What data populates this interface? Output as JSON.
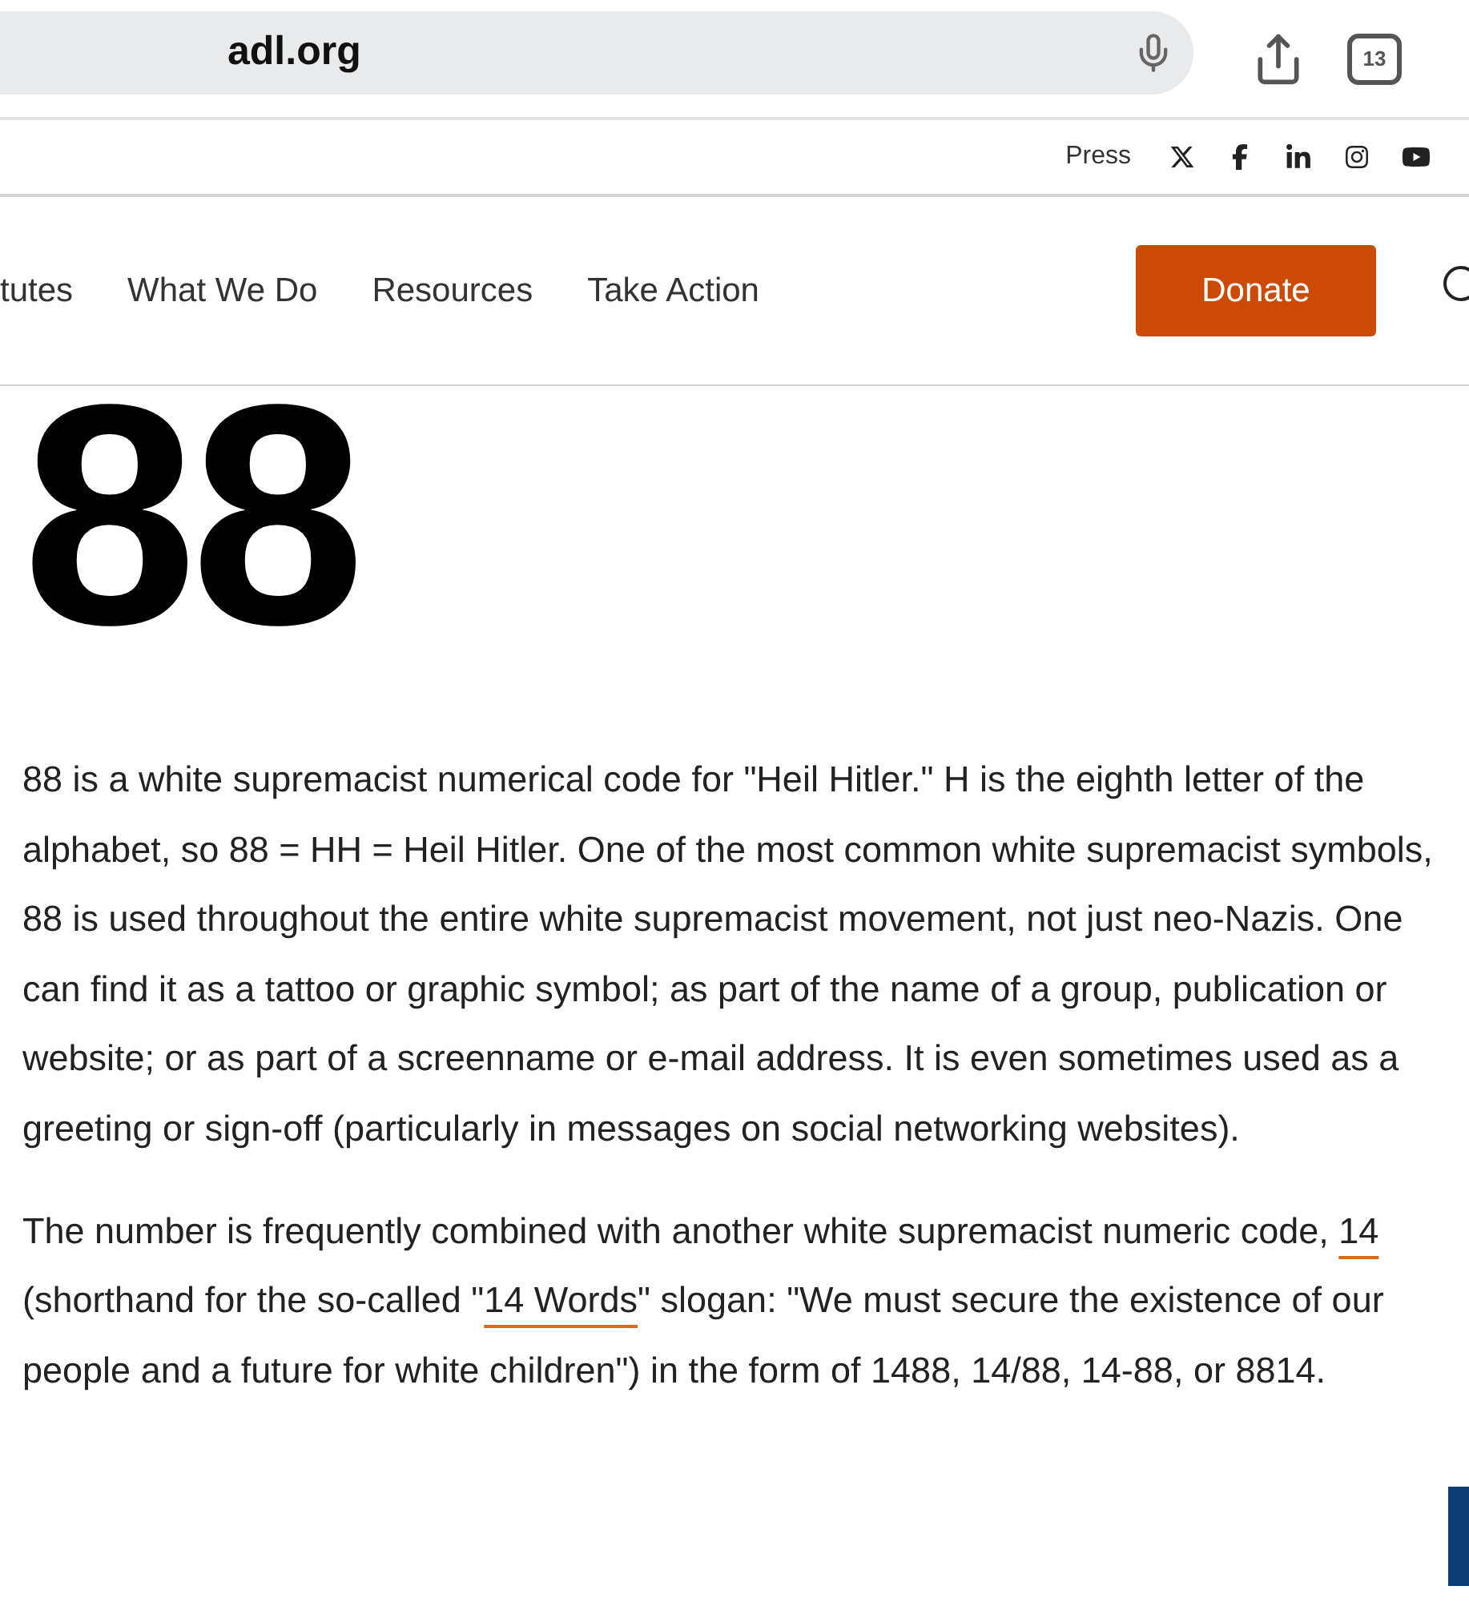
{
  "browser": {
    "url": "adl.org",
    "tab_count": "13"
  },
  "utility_bar": {
    "press": "Press"
  },
  "nav": {
    "items": [
      "tutes",
      "What We Do",
      "Resources",
      "Take Action"
    ],
    "donate": "Donate"
  },
  "heading": "88",
  "paragraphs": [
    [
      {
        "kind": "text",
        "text": "88 is a white supremacist numerical code for \"Heil Hitler.\" H is the eighth letter of the alphabet, so 88 = HH = Heil Hitler. One of the most common white supremacist symbols, 88 is used throughout the entire white supremacist movement, not just neo-Nazis. One can find it as a tattoo or graphic symbol; as part of the name of a group, publication or website; or as part of a screenname or e-mail address. It is even sometimes used as a greeting or sign-off (particularly in messages on social networking websites)."
      }
    ],
    [
      {
        "kind": "text",
        "text": "The number is frequently combined with another white supremacist numeric code, "
      },
      {
        "kind": "link",
        "text": "14"
      },
      {
        "kind": "text",
        "text": " (shorthand for the so-called \""
      },
      {
        "kind": "link",
        "text": "14 Words"
      },
      {
        "kind": "text",
        "text": "\" slogan: \"We must secure the existence of our people and a future for white children\") in the form of 1488, 14/88, 14-88, or 8814."
      }
    ]
  ]
}
